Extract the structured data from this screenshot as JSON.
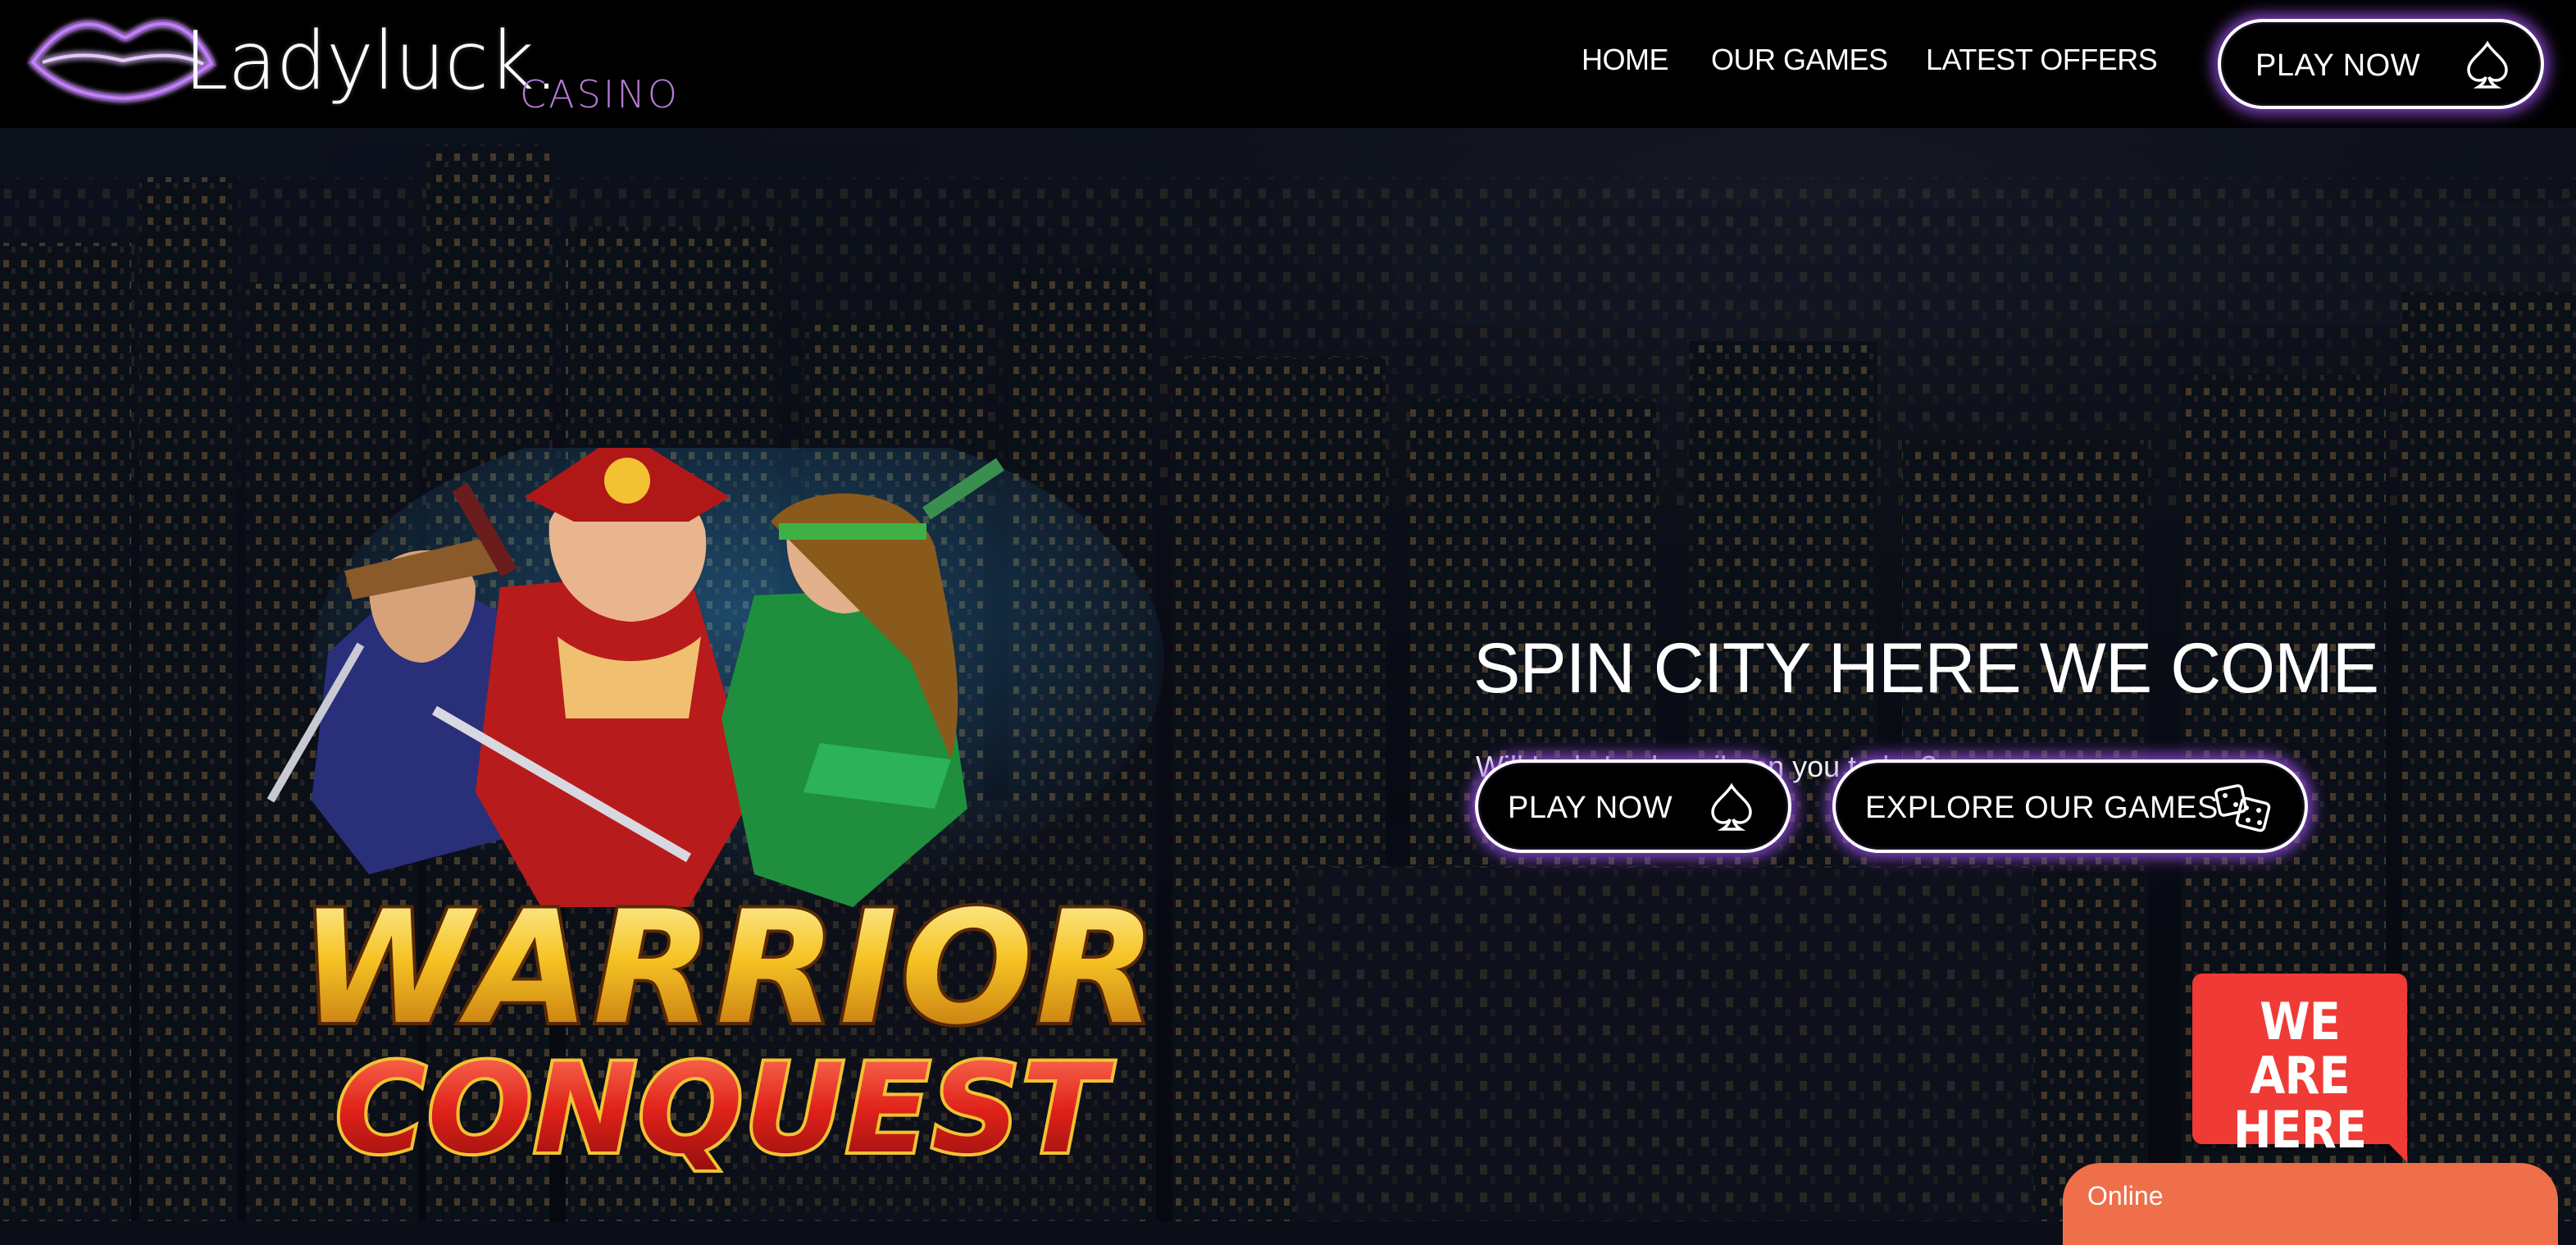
{
  "brand": {
    "name": "Ladyluck.",
    "sub": "CASINO",
    "accent_color": "#b47bd6",
    "logo_icon": "neon-lips-icon"
  },
  "nav": {
    "items": [
      {
        "label": "HOME"
      },
      {
        "label": "OUR GAMES"
      },
      {
        "label": "LATEST OFFERS"
      }
    ],
    "cta": {
      "label": "PLAY NOW",
      "icon": "spade-icon"
    }
  },
  "hero": {
    "title": "SPIN CITY HERE WE COME",
    "subtitle": "Will Lady Luck smile on you today?",
    "buttons": [
      {
        "label": "PLAY NOW",
        "icon": "spade-icon"
      },
      {
        "label": "EXPLORE OUR GAMES",
        "icon": "dice-icon"
      }
    ],
    "game_art": {
      "line1": "WARRIOR",
      "line2": "CONQUEST"
    }
  },
  "chat": {
    "badge": "WE ARE HERE",
    "badge_line1": "WE ARE",
    "badge_line2": "HERE",
    "status": "Online",
    "badge_color": "#f03a35",
    "bar_color": "#ef6f4a"
  }
}
